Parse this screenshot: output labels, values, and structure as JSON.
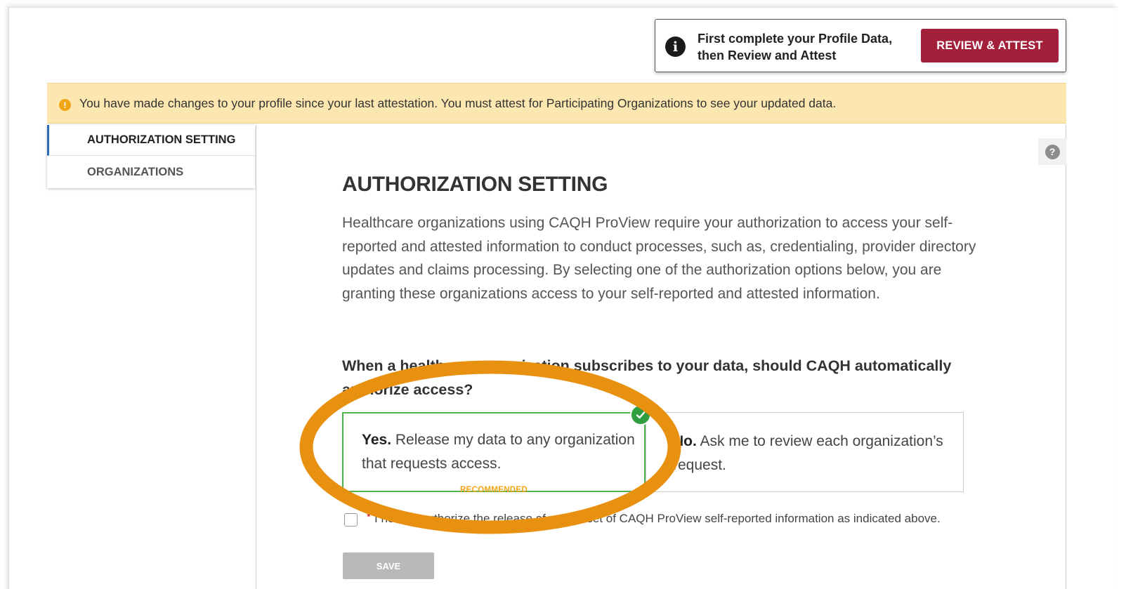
{
  "notice": {
    "text": "First complete your Profile Data, then Review and Attest",
    "button_label": "REVIEW & ATTEST"
  },
  "banner": {
    "text": "You have made changes to your profile since your last attestation. You must attest for Participating Organizations to see your updated data."
  },
  "sidebar": {
    "items": [
      {
        "label": "AUTHORIZATION SETTING",
        "active": true
      },
      {
        "label": "ORGANIZATIONS",
        "active": false
      }
    ]
  },
  "main": {
    "title": "AUTHORIZATION SETTING",
    "intro": "Healthcare organizations using CAQH ProView require your authorization to access your self-reported and attested information to conduct processes, such as, credentialing, provider directory updates and claims processing. By selecting one of the authorization options below, you are granting these organizations access to your self-reported and attested information.",
    "question": "When a healthcare organization subscribes to your data, should CAQH automatically authorize access?",
    "options": {
      "yes": {
        "bold": "Yes.",
        "text": " Release my data to any organization that requests access.",
        "badge": "RECOMMENDED",
        "selected": true
      },
      "no": {
        "bold": "No.",
        "text": " Ask me to review each organization’s request.",
        "selected": false
      }
    },
    "agree": {
      "required_mark": "*",
      "text": "I hereby authorize the release of my full set of CAQH ProView self-reported information as indicated above.",
      "checked": false
    },
    "save_label": "SAVE"
  },
  "colors": {
    "accent_button": "#a3203a",
    "banner_bg": "#fde7b0",
    "selected_border": "#4fb24f",
    "highlight_ring": "#e8900f"
  }
}
